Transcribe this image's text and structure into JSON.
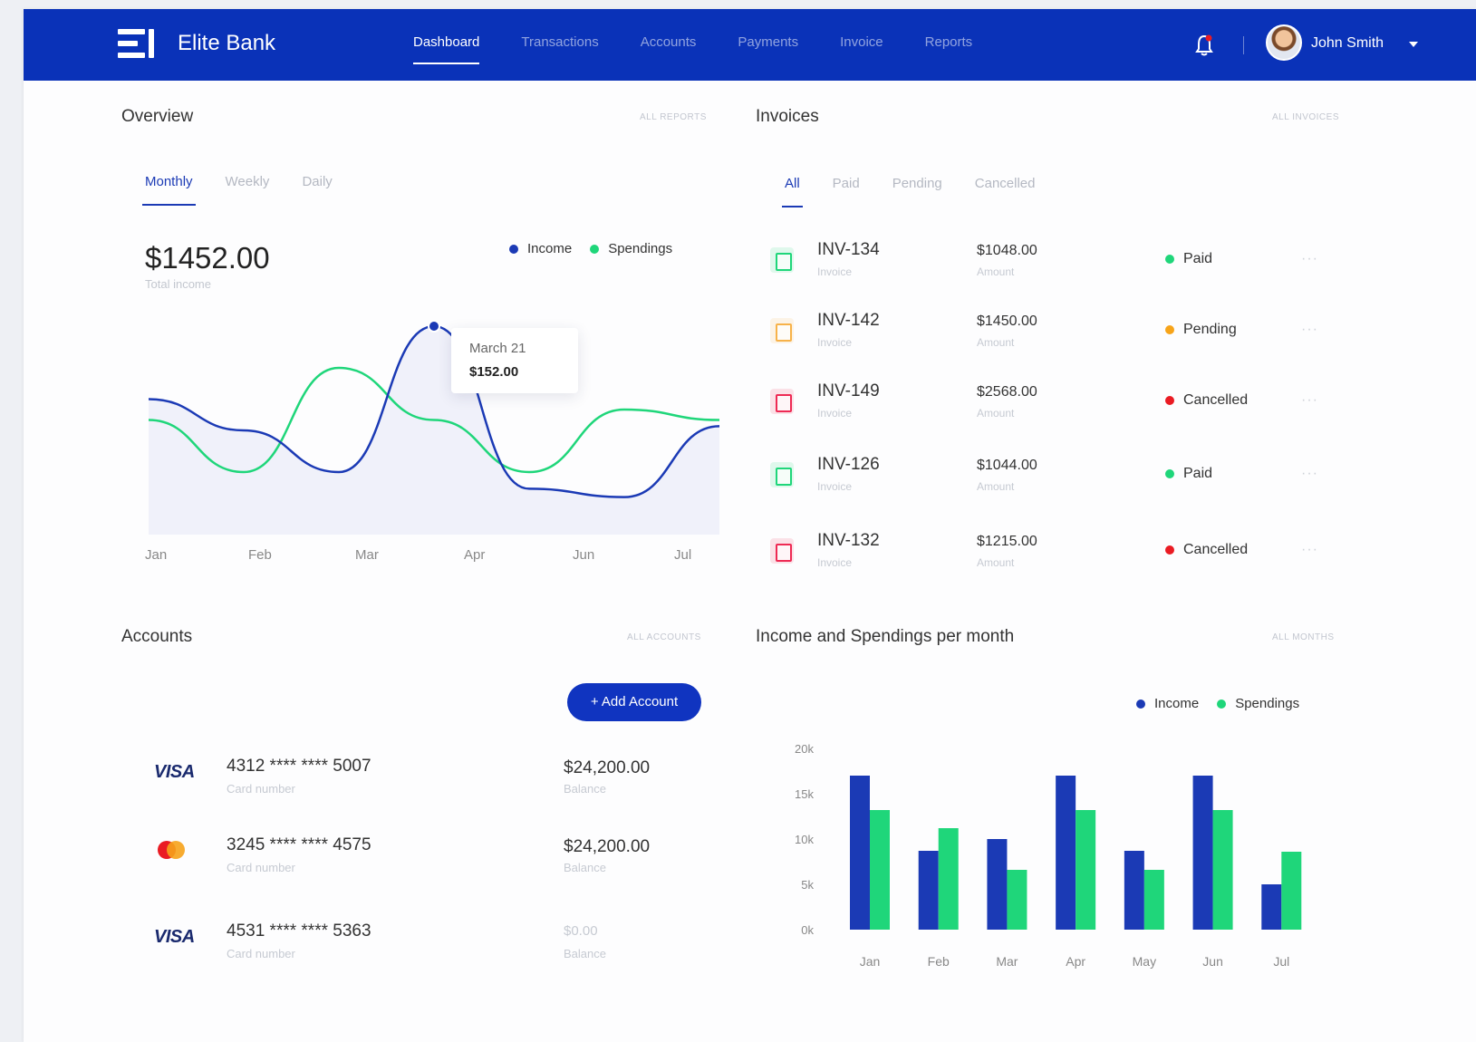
{
  "app": {
    "brand": "Elite Bank",
    "nav": [
      "Dashboard",
      "Transactions",
      "Accounts",
      "Payments",
      "Invoice",
      "Reports"
    ],
    "active_nav": "Dashboard",
    "user": "John Smith",
    "icons": [
      "logo-icon",
      "bell-icon",
      "avatar",
      "caret-down-icon"
    ]
  },
  "colors": {
    "primary": "#0a32b8",
    "income": "#1b3ab5",
    "spendings": "#1fd67a",
    "paid": "#1fd67a",
    "pending": "#f7a419",
    "cancelled": "#ea1b23"
  },
  "overview": {
    "title": "Overview",
    "link": "ALL REPORTS",
    "tabs": [
      "Monthly",
      "Weekly",
      "Daily"
    ],
    "active_tab": "Monthly",
    "total": "$1452.00",
    "total_label": "Total income",
    "legend": [
      "Income",
      "Spendings"
    ],
    "tooltip": {
      "date": "March 21",
      "value": "$152.00"
    },
    "months": [
      "Jan",
      "Feb",
      "Mar",
      "Apr",
      "Jun",
      "Jul"
    ]
  },
  "invoices": {
    "title": "Invoices",
    "link": "ALL INVOICES",
    "tabs": [
      "All",
      "Paid",
      "Pending",
      "Cancelled"
    ],
    "active_tab": "All",
    "rows": [
      {
        "id": "INV-134",
        "sub": "Invoice",
        "amount": "$1048.00",
        "amount_sub": "Amount",
        "status": "Paid",
        "status_color": "#1fd67a",
        "icon_color": "#1fd67a",
        "more": "···"
      },
      {
        "id": "INV-142",
        "sub": "Invoice",
        "amount": "$1450.00",
        "amount_sub": "Amount",
        "status": "Pending",
        "status_color": "#f7a419",
        "icon_color": "#f7b24a",
        "more": "···"
      },
      {
        "id": "INV-149",
        "sub": "Invoice",
        "amount": "$2568.00",
        "amount_sub": "Amount",
        "status": "Cancelled",
        "status_color": "#ea1b23",
        "icon_color": "#ee2a54",
        "more": "···"
      },
      {
        "id": "INV-126",
        "sub": "Invoice",
        "amount": "$1044.00",
        "amount_sub": "Amount",
        "status": "Paid",
        "status_color": "#1fd67a",
        "icon_color": "#1fd67a",
        "more": "···"
      },
      {
        "id": "INV-132",
        "sub": "Invoice",
        "amount": "$1215.00",
        "amount_sub": "Amount",
        "status": "Cancelled",
        "status_color": "#ea1b23",
        "icon_color": "#ee2a54",
        "more": "···"
      }
    ]
  },
  "accounts": {
    "title": "Accounts",
    "link": "ALL ACCOUNTS",
    "add_button": "+ Add Account",
    "rows": [
      {
        "brand": "VISA",
        "number": "4312 **** **** 5007",
        "sub": "Card number",
        "balance": "$24,200.00",
        "balance_sub": "Balance"
      },
      {
        "brand": "mastercard-icon",
        "number": "3245 **** **** 4575",
        "sub": "Card number",
        "balance": "$24,200.00",
        "balance_sub": "Balance"
      },
      {
        "brand": "VISA",
        "number": "4531 **** **** 5363",
        "sub": "Card number",
        "balance": "$0.00",
        "balance_sub": "Balance"
      }
    ]
  },
  "income_spendings": {
    "title": "Income and Spendings per month",
    "link": "ALL MONTHS"
  },
  "chart_data": [
    {
      "type": "line",
      "title": "",
      "x": [
        "Jan",
        "Feb",
        "Mar",
        "Apr",
        "Jun",
        "Jul"
      ],
      "series": [
        {
          "name": "Income",
          "values": [
            65,
            50,
            30,
            100,
            22,
            18,
            52
          ]
        },
        {
          "name": "Spendings",
          "values": [
            55,
            30,
            80,
            55,
            30,
            60,
            55
          ]
        }
      ],
      "legend": "top-right",
      "grid": false
    },
    {
      "type": "bar",
      "title": "Income and Spendings per month",
      "categories": [
        "Jan",
        "Feb",
        "Mar",
        "Apr",
        "May",
        "Jun",
        "Jul"
      ],
      "series": [
        {
          "name": "Income",
          "values": [
            17000,
            8700,
            10000,
            17000,
            8700,
            17000,
            5000
          ]
        },
        {
          "name": "Spendings",
          "values": [
            13200,
            11200,
            6600,
            13200,
            6600,
            13200,
            8600
          ]
        }
      ],
      "yticks": [
        "20k",
        "15k",
        "10k",
        "5k",
        "0k"
      ],
      "ylim": [
        0,
        20000
      ],
      "legend": "top-right",
      "grid": false
    }
  ]
}
